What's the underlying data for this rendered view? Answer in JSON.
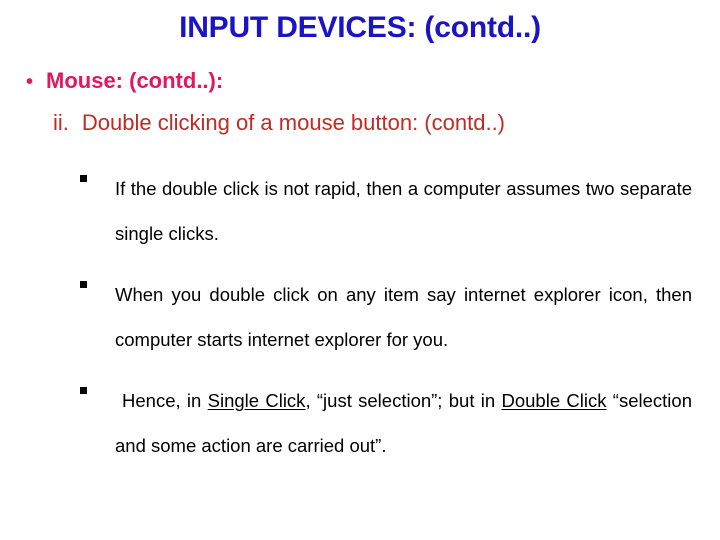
{
  "slide": {
    "title": "INPUT DEVICES: (contd..)",
    "title_color": "#1a14c4",
    "background_color": "#ffffff"
  },
  "level1": {
    "bullet_glyph": "•",
    "text": "Mouse: (contd..):",
    "color": "#e3175f"
  },
  "level2": {
    "marker": "ii.",
    "text": "Double clicking of a mouse button: (contd..)",
    "color": "#c22a22"
  },
  "bullets": {
    "marker_glyph": "▪",
    "color": "#000000",
    "items": [
      {
        "id": "bullet-not-rapid",
        "parts": [
          {
            "text": "If the double click is not rapid, then a computer assumes two separate single clicks.",
            "underline": false
          }
        ]
      },
      {
        "id": "bullet-internet-explorer",
        "parts": [
          {
            "text": "When you double click on any item say internet explorer icon, then computer starts internet explorer for you.",
            "underline": false
          }
        ]
      },
      {
        "id": "bullet-hence-single-double",
        "leading_space": true,
        "parts": [
          {
            "text": "Hence, in ",
            "underline": false
          },
          {
            "text": "Single Click",
            "underline": true
          },
          {
            "text": ", “just selection”; but in ",
            "underline": false
          },
          {
            "text": "Double Click",
            "underline": true
          },
          {
            "text": " “selection and some action are carried out”.",
            "underline": false
          }
        ]
      }
    ]
  }
}
